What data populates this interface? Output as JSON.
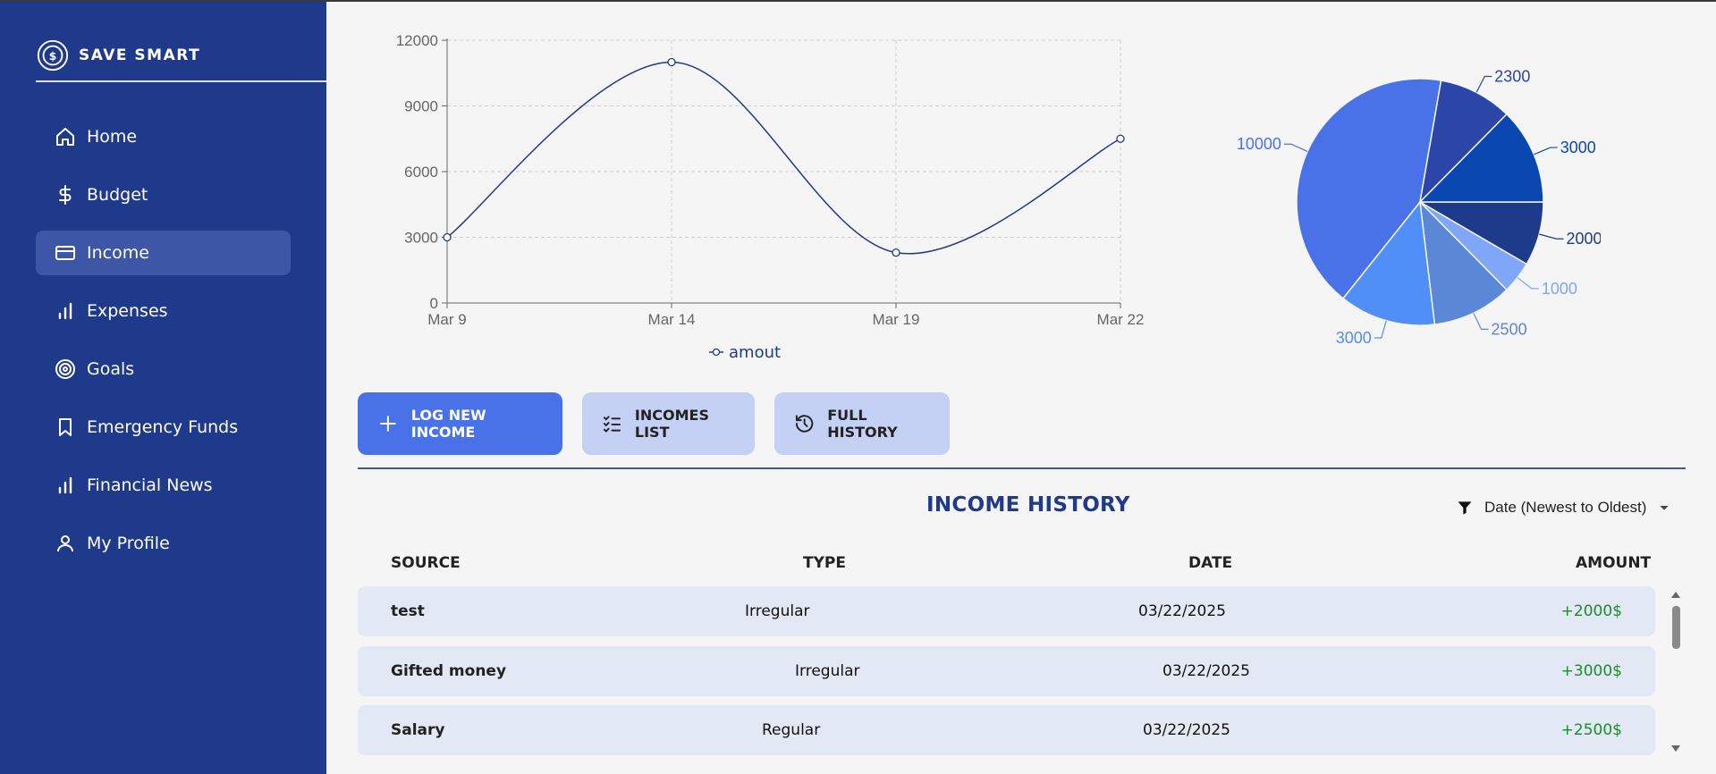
{
  "app": {
    "brand": "SAVE SMART"
  },
  "sidebar": {
    "items": [
      {
        "label": "Home",
        "icon": "home-icon"
      },
      {
        "label": "Budget",
        "icon": "dollar-icon"
      },
      {
        "label": "Income",
        "icon": "card-icon",
        "active": true
      },
      {
        "label": "Expenses",
        "icon": "bar-chart-icon"
      },
      {
        "label": "Goals",
        "icon": "target-icon"
      },
      {
        "label": "Emergency Funds",
        "icon": "bookmark-icon"
      },
      {
        "label": "Financial News",
        "icon": "bar-chart-icon"
      },
      {
        "label": "My Profile",
        "icon": "user-icon"
      }
    ]
  },
  "chart_data": [
    {
      "type": "line",
      "x": [
        "Mar 9",
        "Mar 14",
        "Mar 19",
        "Mar 22"
      ],
      "series": [
        {
          "name": "amout",
          "values": [
            3000,
            11000,
            2300,
            7500
          ]
        }
      ],
      "yticks": [
        0,
        3000,
        6000,
        9000,
        12000
      ],
      "ylim": [
        0,
        12000
      ],
      "grid": true,
      "legend": "bottom",
      "color": "#1f3a8a"
    },
    {
      "type": "pie",
      "labels": [
        "2000",
        "1000",
        "2500",
        "3000",
        "10000",
        "2300",
        "3000"
      ],
      "values": [
        2000,
        1000,
        2500,
        3000,
        10000,
        2300,
        3000
      ],
      "colors": [
        "#1e3a8a",
        "#7fa6f7",
        "#5b88d6",
        "#4f8ff7",
        "#4a72e8",
        "#2b45a8",
        "#0a47b0"
      ]
    }
  ],
  "actions": {
    "log_new": "LOG NEW INCOME",
    "incomes_list": "INCOMES LIST",
    "full_history": "FULL HISTORY"
  },
  "history": {
    "title": "INCOME HISTORY",
    "sort_label": "Date (Newest to Oldest)",
    "columns": [
      "SOURCE",
      "TYPE",
      "DATE",
      "AMOUNT"
    ],
    "rows": [
      {
        "source": "test",
        "type": "Irregular",
        "date": "03/22/2025",
        "amount": "+2000$"
      },
      {
        "source": "Gifted money",
        "type": "Irregular",
        "date": "03/22/2025",
        "amount": "+3000$"
      },
      {
        "source": "Salary",
        "type": "Regular",
        "date": "03/22/2025",
        "amount": "+2500$"
      }
    ]
  }
}
